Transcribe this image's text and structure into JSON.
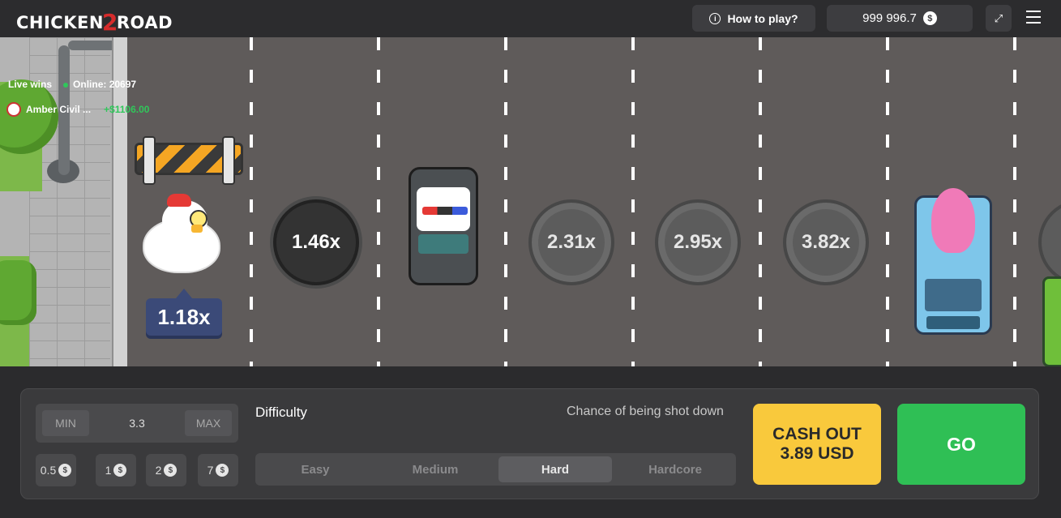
{
  "header": {
    "logo_text_1": "CHICKEN",
    "logo_text_2": "2",
    "logo_text_3": "ROAD",
    "how_to_play": "How to play?",
    "balance": "999 996.7",
    "currency_symbol": "$"
  },
  "live": {
    "label": "Live wins",
    "online": "Online: 20697",
    "winner_name": "Amber Civil ...",
    "winner_amount": "+$1106.00"
  },
  "game": {
    "chicken_multiplier": "1.18x",
    "lanes": [
      {
        "multiplier": "1.46x"
      },
      {
        "multiplier": "2.31x"
      },
      {
        "multiplier": "2.95x"
      },
      {
        "multiplier": "3.82x"
      }
    ]
  },
  "controls": {
    "min_label": "MIN",
    "max_label": "MAX",
    "bet_value": "3.3",
    "chips": [
      "0.5",
      "1",
      "2",
      "7"
    ],
    "difficulty_label": "Difficulty",
    "chance_label": "Chance of being shot down",
    "difficulties": [
      "Easy",
      "Medium",
      "Hard",
      "Hardcore"
    ],
    "selected_difficulty": "Hard",
    "cashout_line1": "CASH OUT",
    "cashout_line2": "3.89 USD",
    "go_label": "GO"
  },
  "colors": {
    "accent_yellow": "#f9c93c",
    "accent_green": "#2fbf55",
    "panel": "#3a3a3c"
  }
}
